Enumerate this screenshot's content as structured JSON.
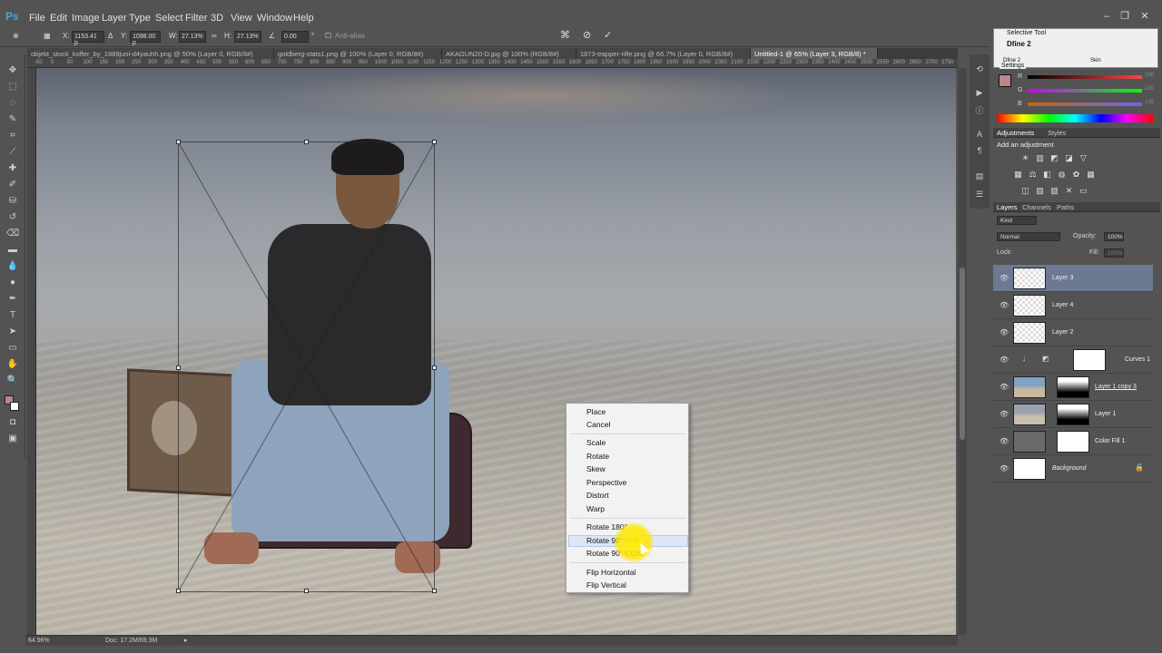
{
  "app": {
    "logo": "Ps"
  },
  "menu": [
    "File",
    "Edit",
    "Image",
    "Layer",
    "Type",
    "Select",
    "Filter",
    "3D",
    "View",
    "Window",
    "Help"
  ],
  "window_controls": {
    "minimize": "–",
    "restore": "❐",
    "close": "✕"
  },
  "options_bar": {
    "x_label": "X:",
    "x_value": "1153.41 p",
    "y_label": "Y:",
    "y_value": "1098.00 p",
    "w_label": "W:",
    "w_value": "27.13%",
    "h_label": "H:",
    "h_value": "27.13%",
    "angle_value": "0.00",
    "angle_unit": "°",
    "antialias_label": "Anti-alias"
  },
  "tabs": [
    "objekt_stock_koffer_by_1989juni-d4yauhh.png @ 50% (Layer 0, RGB/8#)",
    "goldberg-stats1.png @ 100% (Layer 0, RGB/8#)",
    "AKAGUN20-D.jpg @ 100% (RGB/8#)",
    "1873-trapper-rifle.png @ 66.7% (Layer 0, RGB/8#)",
    "Untitled-1 @ 65% (Layer 3, RGB/8) *"
  ],
  "ruler_ticks": [
    "-50",
    "0",
    "50",
    "100",
    "150",
    "200",
    "250",
    "300",
    "350",
    "400",
    "450",
    "500",
    "550",
    "600",
    "650",
    "700",
    "750",
    "800",
    "850",
    "900",
    "950",
    "1000",
    "1050",
    "1100",
    "1150",
    "1200",
    "1250",
    "1300",
    "1350",
    "1400",
    "1450",
    "1500",
    "1550",
    "1600",
    "1650",
    "1700",
    "1750",
    "1800",
    "1850",
    "1900",
    "1950",
    "2000",
    "2050",
    "2100",
    "2150",
    "2200",
    "2250",
    "2300",
    "2350",
    "2400",
    "2450",
    "2500",
    "2550",
    "2600",
    "2650",
    "2700",
    "2750"
  ],
  "context_menu": {
    "items_group1": [
      "Place",
      "Cancel"
    ],
    "items_group2": [
      "Scale",
      "Rotate",
      "Skew",
      "Perspective",
      "Distort",
      "Warp"
    ],
    "items_group3": [
      "Rotate 180°",
      "Rotate 90° CW",
      "Rotate 90° CCW"
    ],
    "items_group4": [
      "Flip Horizontal",
      "Flip Vertical"
    ],
    "highlighted": "Rotate 90° CW"
  },
  "status_bar": {
    "zoom": "64.96%",
    "doc": "Doc: 17.2M/69.3M"
  },
  "selective_tool": {
    "title": "Selective Tool",
    "preset": "Dfine 2",
    "row_a": "Dfine 2",
    "row_b": "Skin",
    "settings": "Settings"
  },
  "color_panel": {
    "r_label": "R",
    "g_label": "G",
    "b_label": "B",
    "r_value": "188",
    "g_value": "135",
    "b_value": "139"
  },
  "adjustments": {
    "tab_active": "Adjustments",
    "tab_other": "Styles",
    "hint": "Add an adjustment"
  },
  "layers_panel": {
    "tabs": [
      "Layers",
      "Channels",
      "Paths"
    ],
    "filter": "Kind",
    "blend_mode": "Normal",
    "opacity_label": "Opacity:",
    "opacity_value": "100%",
    "lock_label": "Lock:",
    "fill_label": "Fill:",
    "fill_value": "100%",
    "layers": [
      {
        "name": "Layer 3",
        "selected": true
      },
      {
        "name": "Layer 4",
        "selected": false
      },
      {
        "name": "Layer 2",
        "selected": false
      },
      {
        "name": "Curves 1",
        "selected": false
      },
      {
        "name": "Layer 1 copy 3",
        "selected": false
      },
      {
        "name": "Layer 1",
        "selected": false
      },
      {
        "name": "Color Fill 1",
        "selected": false
      },
      {
        "name": "Background",
        "selected": false
      }
    ]
  },
  "colors": {
    "ui_bg": "#535353",
    "accent": "#4aa3df",
    "layer_selected": "#6b7993",
    "cursor_highlight": "#ffee00"
  }
}
